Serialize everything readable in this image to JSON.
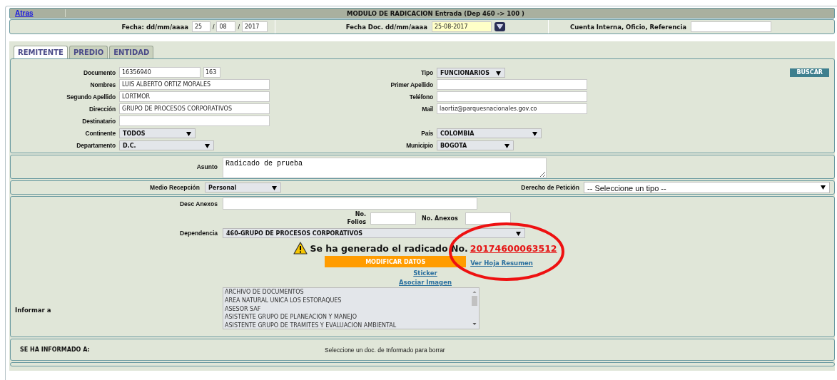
{
  "header": {
    "back_link": "Atras",
    "title": "MODULO DE RADICACION Entrada (Dep 460 -> 100 )"
  },
  "dates": {
    "fecha_label": "Fecha: dd/mm/aaaa",
    "day": "25",
    "separator_1": "/",
    "month": "08",
    "separator_2": "/",
    "year": "2017",
    "fecha_doc_label": "Fecha Doc. dd/mm/aaaa",
    "fecha_doc_value": "25-08-2017",
    "reference_label": "Cuenta Interna, Oficio, Referencia"
  },
  "tabs": [
    {
      "label": "REMITENTE",
      "selected": true
    },
    {
      "label": "PREDIO",
      "selected": false
    },
    {
      "label": "ENTIDAD",
      "selected": false
    }
  ],
  "remitente": {
    "search_button": "BUSCAR",
    "rows": [
      {
        "left": {
          "label": "Documento",
          "kind": "document",
          "value": "16356940",
          "extra": "163"
        },
        "right": {
          "label": "Tipo",
          "kind": "select",
          "value": "FUNCIONARIOS"
        }
      },
      {
        "left": {
          "label": "Nombres",
          "kind": "text",
          "value": "LUIS ALBERTO ORTIZ MORALES"
        },
        "right": {
          "label": "Primer Apellido",
          "kind": "text"
        }
      },
      {
        "left": {
          "label": "Segundo Apellido",
          "kind": "text",
          "value": "LORTMOR"
        },
        "right": {
          "label": "Teléfono",
          "kind": "text"
        }
      },
      {
        "left": {
          "label": "Dirección",
          "kind": "text",
          "value": "GRUPO DE PROCESOS CORPORATIVOS"
        },
        "right": {
          "label": "Mail",
          "kind": "text",
          "value": "laortiz@parquesnacionales.gov.co"
        }
      },
      {
        "left": {
          "label": "Destinatario",
          "kind": "text"
        }
      },
      {
        "left": {
          "label": "Continente",
          "kind": "select",
          "value": "TODOS"
        },
        "right": {
          "label": "País",
          "kind": "select",
          "value": "COLOMBIA"
        }
      },
      {
        "left": {
          "label": "Departamento",
          "kind": "select",
          "value": "D.C."
        },
        "right": {
          "label": "Municipio",
          "kind": "select",
          "value": "BOGOTA"
        }
      }
    ]
  },
  "asunto": {
    "label": "Asunto",
    "value": "Radicado de prueba"
  },
  "recepcion": {
    "medio_label": "Medio Recepción",
    "medio_value": "Personal",
    "derecho_label": "Derecho de Petición",
    "derecho_value": "-- Seleccione un tipo --"
  },
  "anexos": {
    "desc_label": "Desc Anexos",
    "folios_label": "No. Folios",
    "anexos_label": "No. Anexos",
    "dependencia_label": "Dependencia",
    "dependencia_value": "460-GRUPO DE PROCESOS CORPORATIVOS"
  },
  "result": {
    "message": "Se ha generado el radicado No.",
    "number": "20174600063512",
    "modify_button": "MODIFICAR DATOS",
    "summary_link": "Ver Hoja Resumen",
    "sticker_link": "Sticker",
    "image_link": "Asociar Imagen"
  },
  "informar": {
    "label": "Informar a",
    "options": [
      "ARCHIVO DE DOCUMENTOS",
      "AREA NATURAL UNICA LOS ESTORAQUES",
      "ASESOR SAF",
      "ASISTENTE GRUPO DE PLANEACION Y MANEJO",
      "ASISTENTE GRUPO DE TRAMITES Y EVALUACION AMBIENTAL"
    ]
  },
  "informado": {
    "label": "SE HA INFORMADO A:",
    "hint": "Seleccione un doc. de Informado para borrar"
  }
}
